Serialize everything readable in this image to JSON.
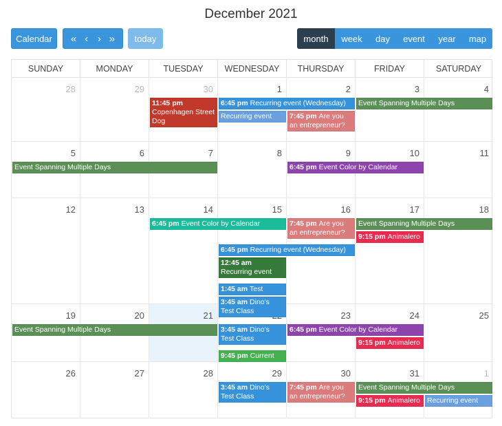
{
  "header": {
    "title": "December 2021"
  },
  "toolbar": {
    "calendar_label": "Calendar",
    "nav": {
      "prev_year": "«",
      "prev": "‹",
      "next": "›",
      "next_year": "»"
    },
    "today_label": "today",
    "views": [
      {
        "label": "month",
        "active": true
      },
      {
        "label": "week",
        "active": false
      },
      {
        "label": "day",
        "active": false
      },
      {
        "label": "event",
        "active": false
      },
      {
        "label": "year",
        "active": false
      },
      {
        "label": "map",
        "active": false
      }
    ]
  },
  "weekdays": [
    "SUNDAY",
    "MONDAY",
    "TUESDAY",
    "WEDNESDAY",
    "THURSDAY",
    "FRIDAY",
    "SATURDAY"
  ],
  "weeks": [
    {
      "days": [
        {
          "num": "28",
          "other": true
        },
        {
          "num": "29",
          "other": true
        },
        {
          "num": "30",
          "other": true
        },
        {
          "num": "1"
        },
        {
          "num": "2"
        },
        {
          "num": "3"
        },
        {
          "num": "4"
        }
      ]
    },
    {
      "days": [
        {
          "num": "5"
        },
        {
          "num": "6"
        },
        {
          "num": "7"
        },
        {
          "num": "8"
        },
        {
          "num": "9"
        },
        {
          "num": "10"
        },
        {
          "num": "11"
        }
      ]
    },
    {
      "days": [
        {
          "num": "12"
        },
        {
          "num": "13"
        },
        {
          "num": "14"
        },
        {
          "num": "15"
        },
        {
          "num": "16"
        },
        {
          "num": "17"
        },
        {
          "num": "18"
        }
      ]
    },
    {
      "days": [
        {
          "num": "19"
        },
        {
          "num": "20"
        },
        {
          "num": "21",
          "today": true
        },
        {
          "num": "22"
        },
        {
          "num": "23"
        },
        {
          "num": "24"
        },
        {
          "num": "25"
        }
      ]
    },
    {
      "days": [
        {
          "num": "26"
        },
        {
          "num": "27"
        },
        {
          "num": "28"
        },
        {
          "num": "29"
        },
        {
          "num": "30"
        },
        {
          "num": "31"
        },
        {
          "num": "1",
          "other": true
        }
      ]
    }
  ],
  "events": [
    {
      "week": 0,
      "col": 2,
      "span": 1,
      "slot": 0,
      "lines": 3,
      "time": "11:45 pm",
      "title": "Copenhagen Street Dog Championships",
      "color": "red"
    },
    {
      "week": 0,
      "col": 3,
      "span": 2,
      "slot": 0,
      "lines": 1,
      "time": "6:45 pm",
      "title": "Recurring event (Wednesday)",
      "color": "blue"
    },
    {
      "week": 0,
      "col": 5,
      "span": 2,
      "slot": 0,
      "lines": 1,
      "time": "",
      "title": "Event Spanning Multiple Days",
      "color": "green"
    },
    {
      "week": 0,
      "col": 3,
      "span": 1,
      "slot": 1,
      "lines": 1,
      "time": "",
      "title": "Recurring event demo",
      "color": "lightblue"
    },
    {
      "week": 0,
      "col": 4,
      "span": 1,
      "slot": 1,
      "lines": 2,
      "time": "7:45 pm",
      "title": "Are you an entrepreneur?",
      "color": "pink"
    },
    {
      "week": 1,
      "col": 0,
      "span": 3,
      "slot": 0,
      "lines": 1,
      "time": "",
      "title": "Event Spanning Multiple Days",
      "color": "green"
    },
    {
      "week": 1,
      "col": 4,
      "span": 2,
      "slot": 0,
      "lines": 1,
      "time": "6:45 pm",
      "title": "Event Color by Calendar (Purple)",
      "color": "purple"
    },
    {
      "week": 2,
      "col": 2,
      "span": 2,
      "slot": 0,
      "lines": 1,
      "time": "6:45 pm",
      "title": "Event Color by Calendar (Green)",
      "color": "teal"
    },
    {
      "week": 2,
      "col": 4,
      "span": 1,
      "slot": 0,
      "lines": 2,
      "time": "7:45 pm",
      "title": "Are you an entrepreneur?",
      "color": "pink"
    },
    {
      "week": 2,
      "col": 5,
      "span": 2,
      "slot": 0,
      "lines": 1,
      "time": "",
      "title": "Event Spanning Multiple Days",
      "color": "green"
    },
    {
      "week": 2,
      "col": 5,
      "span": 1,
      "slot": 1,
      "lines": 1,
      "time": "9:15 pm",
      "title": "Animalero",
      "color": "crimson"
    },
    {
      "week": 2,
      "col": 3,
      "span": 2,
      "slot": 2,
      "lines": 1,
      "time": "6:45 pm",
      "title": "Recurring event (Wednesday)",
      "color": "blue"
    },
    {
      "week": 2,
      "col": 3,
      "span": 1,
      "slot": 3,
      "lines": 2,
      "time": "12:45 am",
      "title": "Recurring event",
      "color": "darkgreen"
    },
    {
      "week": 2,
      "col": 3,
      "span": 1,
      "slot": 5,
      "lines": 1,
      "time": "1:45 am",
      "title": "Test",
      "color": "blue"
    },
    {
      "week": 2,
      "col": 3,
      "span": 1,
      "slot": 6,
      "lines": 2,
      "time": "3:45 am",
      "title": "Dino's Test Class",
      "color": "blue"
    },
    {
      "week": 3,
      "col": 0,
      "span": 3,
      "slot": 0,
      "lines": 1,
      "time": "",
      "title": "Event Spanning Multiple Days",
      "color": "green"
    },
    {
      "week": 3,
      "col": 3,
      "span": 1,
      "slot": 0,
      "lines": 2,
      "time": "3:45 am",
      "title": "Dino's Test Class",
      "color": "blue"
    },
    {
      "week": 3,
      "col": 4,
      "span": 2,
      "slot": 0,
      "lines": 1,
      "time": "6:45 pm",
      "title": "Event Color by Calendar (Purple)",
      "color": "purple"
    },
    {
      "week": 3,
      "col": 5,
      "span": 1,
      "slot": 1,
      "lines": 1,
      "time": "9:15 pm",
      "title": "Animalero",
      "color": "crimson"
    },
    {
      "week": 3,
      "col": 3,
      "span": 1,
      "slot": 2,
      "lines": 1,
      "time": "9:45 pm",
      "title": "Current User",
      "color": "lime"
    },
    {
      "week": 4,
      "col": 3,
      "span": 1,
      "slot": 0,
      "lines": 2,
      "time": "3:45 am",
      "title": "Dino's Test Class",
      "color": "blue"
    },
    {
      "week": 4,
      "col": 4,
      "span": 1,
      "slot": 0,
      "lines": 2,
      "time": "7:45 pm",
      "title": "Are you an entrepreneur?",
      "color": "pink"
    },
    {
      "week": 4,
      "col": 5,
      "span": 2,
      "slot": 0,
      "lines": 1,
      "time": "",
      "title": "Event Spanning Multiple Days",
      "color": "green"
    },
    {
      "week": 4,
      "col": 5,
      "span": 1,
      "slot": 1,
      "lines": 1,
      "time": "9:15 pm",
      "title": "Animalero",
      "color": "crimson"
    },
    {
      "week": 4,
      "col": 6,
      "span": 1,
      "slot": 1,
      "lines": 1,
      "time": "",
      "title": "Recurring event demo",
      "color": "lightblue"
    }
  ]
}
